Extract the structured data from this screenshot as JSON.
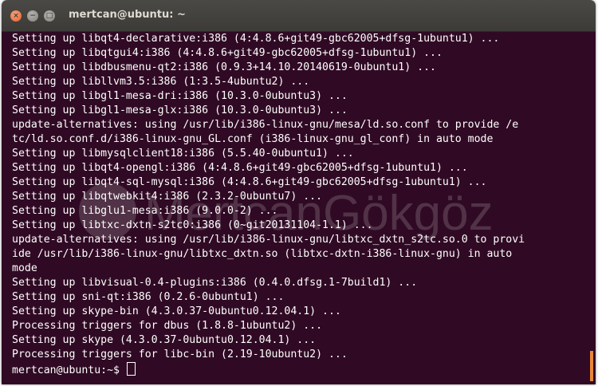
{
  "window": {
    "title": "mertcan@ubuntu: ~",
    "buttons": {
      "close_glyph": "×",
      "minimize_glyph": "−",
      "maximize_glyph": "□"
    }
  },
  "terminal": {
    "background": "#300a24",
    "foreground": "#ffffff",
    "lines": [
      "Setting up libqt4-declarative:i386 (4:4.8.6+git49-gbc62005+dfsg-1ubuntu1) ...",
      "Setting up libqtgui4:i386 (4:4.8.6+git49-gbc62005+dfsg-1ubuntu1) ...",
      "Setting up libdbusmenu-qt2:i386 (0.9.3+14.10.20140619-0ubuntu1) ...",
      "Setting up libllvm3.5:i386 (1:3.5-4ubuntu2) ...",
      "Setting up libgl1-mesa-dri:i386 (10.3.0-0ubuntu3) ...",
      "Setting up libgl1-mesa-glx:i386 (10.3.0-0ubuntu3) ...",
      "update-alternatives: using /usr/lib/i386-linux-gnu/mesa/ld.so.conf to provide /e",
      "tc/ld.so.conf.d/i386-linux-gnu_GL.conf (i386-linux-gnu_gl_conf) in auto mode",
      "Setting up libmysqlclient18:i386 (5.5.40-0ubuntu1) ...",
      "Setting up libqt4-opengl:i386 (4:4.8.6+git49-gbc62005+dfsg-1ubuntu1) ...",
      "Setting up libqt4-sql-mysql:i386 (4:4.8.6+git49-gbc62005+dfsg-1ubuntu1) ...",
      "Setting up libqtwebkit4:i386 (2.3.2-0ubuntu7) ...",
      "Setting up libglu1-mesa:i386 (9.0.0-2) ...",
      "Setting up libtxc-dxtn-s2tc0:i386 (0~git20131104-1.1) ...",
      "update-alternatives: using /usr/lib/i386-linux-gnu/libtxc_dxtn_s2tc.so.0 to provi",
      "ide /usr/lib/i386-linux-gnu/libtxc_dxtn.so (libtxc-dxtn-i386-linux-gnu) in auto",
      "mode",
      "Setting up libvisual-0.4-plugins:i386 (0.4.0.dfsg.1-7build1) ...",
      "Setting up sni-qt:i386 (0.2.6-0ubuntu1) ...",
      "Setting up skype-bin (4.3.0.37-0ubuntu0.12.04.1) ...",
      "Processing triggers for dbus (1.8.8-1ubuntu2) ...",
      "Setting up skype (4.3.0.37-0ubuntu0.12.04.1) ...",
      "Processing triggers for libc-bin (2.19-10ubuntu2) ..."
    ],
    "prompt": "mertcan@ubuntu:~$ "
  },
  "watermark": {
    "text": "MertcanGökgöz"
  },
  "colors": {
    "close_button": "#e35d2a",
    "scroll_indicator": "#e8863a",
    "titlebar": "#3c3b37"
  }
}
